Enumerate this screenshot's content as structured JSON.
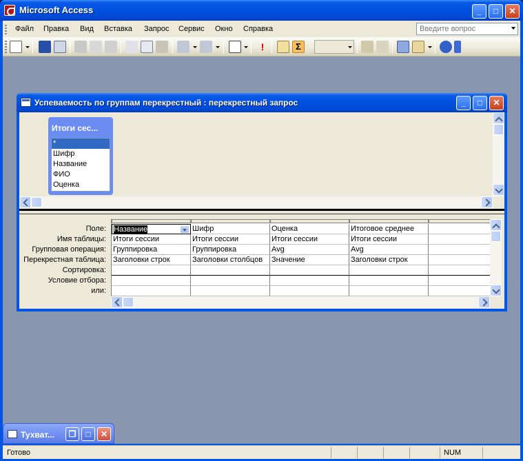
{
  "app": {
    "title": "Microsoft Access"
  },
  "menu": {
    "items": [
      "Файл",
      "Правка",
      "Вид",
      "Вставка",
      "Запрос",
      "Сервис",
      "Окно",
      "Справка"
    ],
    "help_placeholder": "Введите вопрос"
  },
  "query_window": {
    "title": "Успеваемость по группам перекрестный : перекрестный запрос",
    "table": {
      "title": "Итоги сес...",
      "fields": [
        "*",
        "Шифр",
        "Название",
        "ФИО",
        "Оценка"
      ]
    },
    "row_labels": [
      "Поле:",
      "Имя таблицы:",
      "Групповая операция:",
      "Перекрестная таблица:",
      "Сортировка:",
      "Условие отбора:",
      "или:"
    ],
    "columns": [
      {
        "field": "Название",
        "table": "Итоги сессии",
        "group": "Группировка",
        "crosstab": "Заголовки строк"
      },
      {
        "field": "Шифр",
        "table": "Итоги сессии",
        "group": "Группировка",
        "crosstab": "Заголовки столбцов"
      },
      {
        "field": "Оценка",
        "table": "Итоги сессии",
        "group": "Avg",
        "crosstab": "Значение"
      },
      {
        "field": "Итоговое среднее",
        "table": "Итоги сессии",
        "group": "Avg",
        "crosstab": "Заголовки строк"
      }
    ]
  },
  "minimized_window": {
    "title": "Тухват..."
  },
  "status": {
    "text": "Готово",
    "num": "NUM"
  }
}
